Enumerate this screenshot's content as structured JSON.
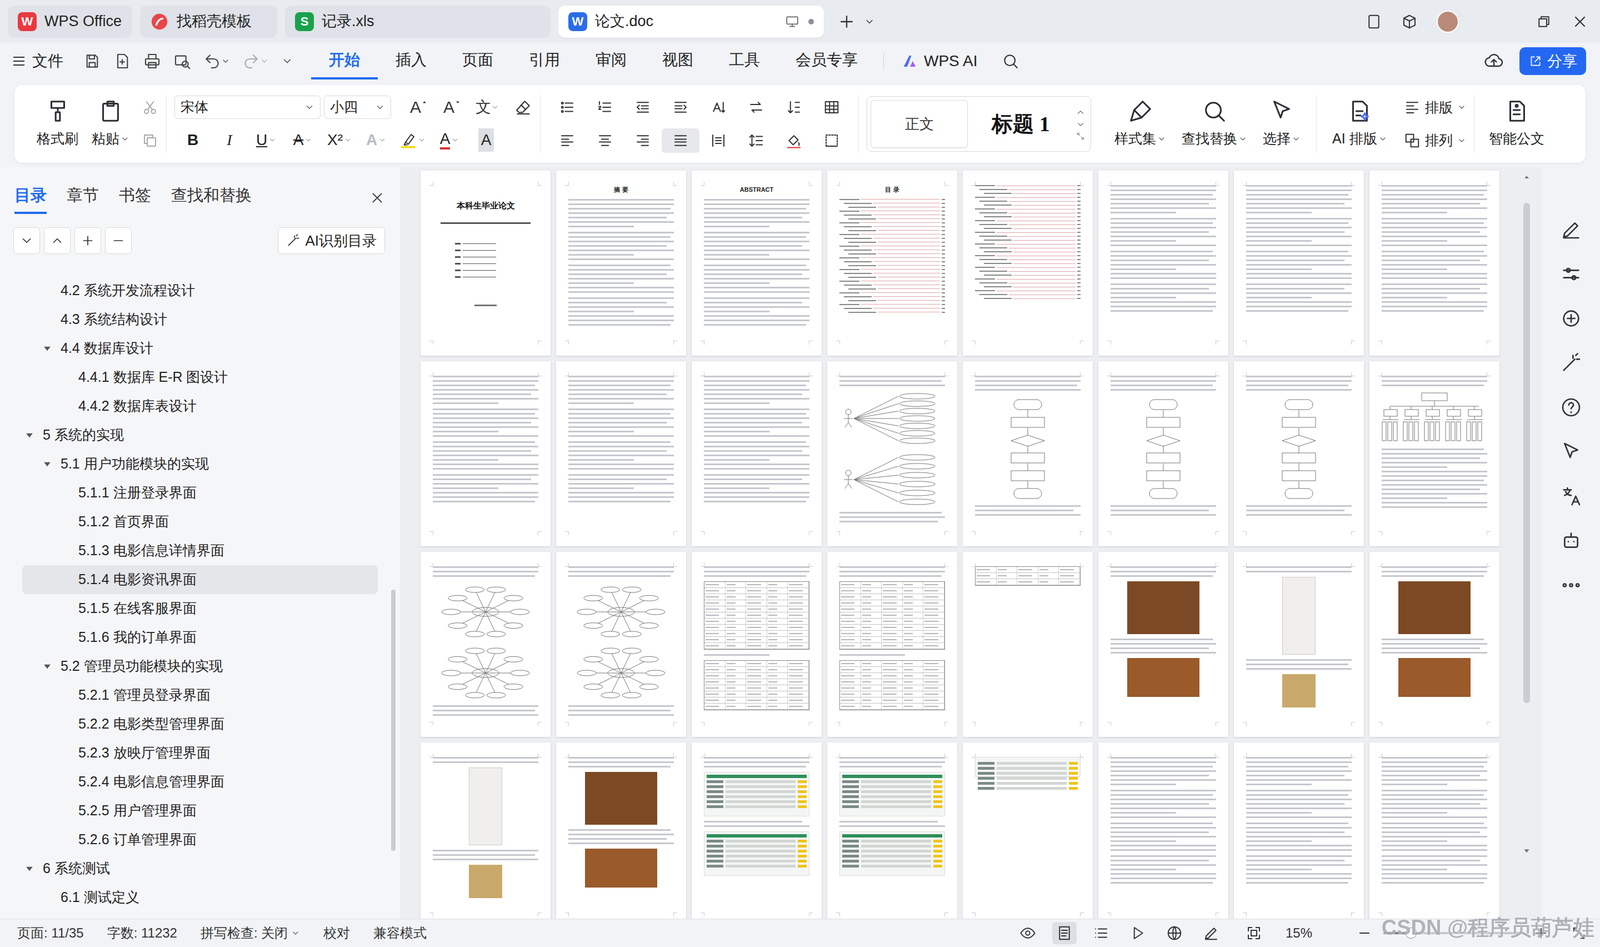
{
  "tabs": [
    {
      "label": "WPS Office",
      "kind": "wps",
      "badge": "W",
      "selected": false,
      "modified": false
    },
    {
      "label": "找稻壳模板",
      "kind": "docer",
      "selected": false,
      "modified": false
    },
    {
      "label": "记录.xls",
      "kind": "sheet",
      "badge": "S",
      "selected": false,
      "modified": false
    },
    {
      "label": "论文.doc",
      "kind": "writer",
      "badge": "W",
      "selected": true,
      "modified": true
    }
  ],
  "menu": {
    "file": "文件",
    "items": [
      {
        "label": "开始",
        "selected": true
      },
      {
        "label": "插入",
        "selected": false
      },
      {
        "label": "页面",
        "selected": false
      },
      {
        "label": "引用",
        "selected": false
      },
      {
        "label": "审阅",
        "selected": false
      },
      {
        "label": "视图",
        "selected": false
      },
      {
        "label": "工具",
        "selected": false
      },
      {
        "label": "会员专享",
        "selected": false
      }
    ],
    "ai": "WPS AI",
    "share": "分享"
  },
  "ribbon": {
    "format_painter": "格式刷",
    "paste": "粘贴",
    "font_name": "宋体",
    "font_size": "小四",
    "size_glyphs": [
      "A",
      "A"
    ],
    "pinyin": "文",
    "format_glyphs": [
      {
        "text": "B",
        "kind": "bold"
      },
      {
        "text": "I",
        "kind": "italic"
      },
      {
        "text": "U",
        "kind": "underline"
      },
      {
        "text": "A",
        "kind": "strike"
      },
      {
        "text": "X²",
        "kind": "super"
      },
      {
        "text": "A",
        "kind": "effect"
      },
      {
        "text": "A",
        "kind": "color"
      },
      {
        "text": "A",
        "kind": "shade"
      }
    ],
    "styles": [
      {
        "label": "正文",
        "kind": "body"
      },
      {
        "label": "标题 1",
        "kind": "heading"
      }
    ],
    "tools": [
      {
        "label": "样式集",
        "kind": "styleset"
      },
      {
        "label": "查找替换",
        "kind": "find"
      },
      {
        "label": "选择",
        "kind": "select"
      },
      {
        "label": "AI 排版",
        "kind": "ai"
      }
    ],
    "arrange": [
      {
        "label": "排版",
        "kind": "layout"
      },
      {
        "label": "排列",
        "kind": "arrange"
      }
    ],
    "smart": "智能公文"
  },
  "nav": {
    "tabs": [
      {
        "label": "目录",
        "selected": true
      },
      {
        "label": "章节",
        "selected": false
      },
      {
        "label": "书签",
        "selected": false
      },
      {
        "label": "查找和替换",
        "selected": false
      }
    ],
    "ai_button": "AI识别目录",
    "items": [
      {
        "label": "4.2 系统开发流程设计",
        "level": 2,
        "kind": "leaf",
        "expanded": false,
        "selected": false
      },
      {
        "label": "4.3 系统结构设计",
        "level": 2,
        "kind": "leaf",
        "expanded": false,
        "selected": false
      },
      {
        "label": "4.4 数据库设计",
        "level": 2,
        "kind": "branch",
        "expanded": true,
        "selected": false
      },
      {
        "label": "4.4.1 数据库 E-R 图设计",
        "level": 3,
        "kind": "leaf",
        "expanded": false,
        "selected": false
      },
      {
        "label": "4.4.2 数据库表设计",
        "level": 3,
        "kind": "leaf",
        "expanded": false,
        "selected": false
      },
      {
        "label": "5 系统的实现",
        "level": 1,
        "kind": "branch",
        "expanded": true,
        "selected": false
      },
      {
        "label": "5.1 用户功能模块的实现",
        "level": 2,
        "kind": "branch",
        "expanded": true,
        "selected": false
      },
      {
        "label": "5.1.1 注册登录界面",
        "level": 3,
        "kind": "leaf",
        "expanded": false,
        "selected": false
      },
      {
        "label": "5.1.2 首页界面",
        "level": 3,
        "kind": "leaf",
        "expanded": false,
        "selected": false
      },
      {
        "label": "5.1.3 电影信息详情界面",
        "level": 3,
        "kind": "leaf",
        "expanded": false,
        "selected": false
      },
      {
        "label": "5.1.4 电影资讯界面",
        "level": 3,
        "kind": "leaf",
        "expanded": false,
        "selected": true
      },
      {
        "label": "5.1.5 在线客服界面",
        "level": 3,
        "kind": "leaf",
        "expanded": false,
        "selected": false
      },
      {
        "label": "5.1.6 我的订单界面",
        "level": 3,
        "kind": "leaf",
        "expanded": false,
        "selected": false
      },
      {
        "label": "5.2 管理员功能模块的实现",
        "level": 2,
        "kind": "branch",
        "expanded": true,
        "selected": false
      },
      {
        "label": "5.2.1 管理员登录界面",
        "level": 3,
        "kind": "leaf",
        "expanded": false,
        "selected": false
      },
      {
        "label": "5.2.2 电影类型管理界面",
        "level": 3,
        "kind": "leaf",
        "expanded": false,
        "selected": false
      },
      {
        "label": "5.2.3 放映厅管理界面",
        "level": 3,
        "kind": "leaf",
        "expanded": false,
        "selected": false
      },
      {
        "label": "5.2.4 电影信息管理界面",
        "level": 3,
        "kind": "leaf",
        "expanded": false,
        "selected": false
      },
      {
        "label": "5.2.5 用户管理界面",
        "level": 3,
        "kind": "leaf",
        "expanded": false,
        "selected": false
      },
      {
        "label": "5.2.6 订单管理界面",
        "level": 3,
        "kind": "leaf",
        "expanded": false,
        "selected": false
      },
      {
        "label": "6 系统测试",
        "level": 1,
        "kind": "branch",
        "expanded": true,
        "selected": false
      },
      {
        "label": "6.1 测试定义",
        "level": 2,
        "kind": "leaf",
        "expanded": false,
        "selected": false
      }
    ]
  },
  "pages": [
    {
      "kind": "title",
      "heading": "本科生毕业论文"
    },
    {
      "kind": "text",
      "heading": "摘 要"
    },
    {
      "kind": "text",
      "heading": "ABSTRACT"
    },
    {
      "kind": "toc",
      "heading": "目 录"
    },
    {
      "kind": "toc"
    },
    {
      "kind": "text"
    },
    {
      "kind": "text"
    },
    {
      "kind": "text"
    },
    {
      "kind": "text"
    },
    {
      "kind": "text"
    },
    {
      "kind": "text"
    },
    {
      "kind": "usecase"
    },
    {
      "kind": "flow"
    },
    {
      "kind": "flow"
    },
    {
      "kind": "flow"
    },
    {
      "kind": "tree"
    },
    {
      "kind": "er"
    },
    {
      "kind": "er"
    },
    {
      "kind": "table"
    },
    {
      "kind": "table"
    },
    {
      "kind": "tableshort"
    },
    {
      "kind": "photo"
    },
    {
      "kind": "phone"
    },
    {
      "kind": "photo"
    },
    {
      "kind": "phone"
    },
    {
      "kind": "photo"
    },
    {
      "kind": "admin"
    },
    {
      "kind": "admin"
    },
    {
      "kind": "adminshort"
    },
    {
      "kind": "text"
    },
    {
      "kind": "text"
    },
    {
      "kind": "text"
    }
  ],
  "status_bar": {
    "page": "页面: 11/35",
    "words": "字数: 11232",
    "spell": "拼写检查: 关闭",
    "proof": "校对",
    "compat": "兼容模式",
    "zoom": "15%",
    "zoom_level": 0.2,
    "view_modes": [
      {
        "kind": "read",
        "selected": false
      },
      {
        "kind": "page",
        "selected": true
      },
      {
        "kind": "outline",
        "selected": false
      },
      {
        "kind": "play",
        "selected": false
      },
      {
        "kind": "web",
        "selected": false
      },
      {
        "kind": "pen",
        "selected": false
      }
    ]
  },
  "watermark": "CSDN @程序员葫芦娃"
}
